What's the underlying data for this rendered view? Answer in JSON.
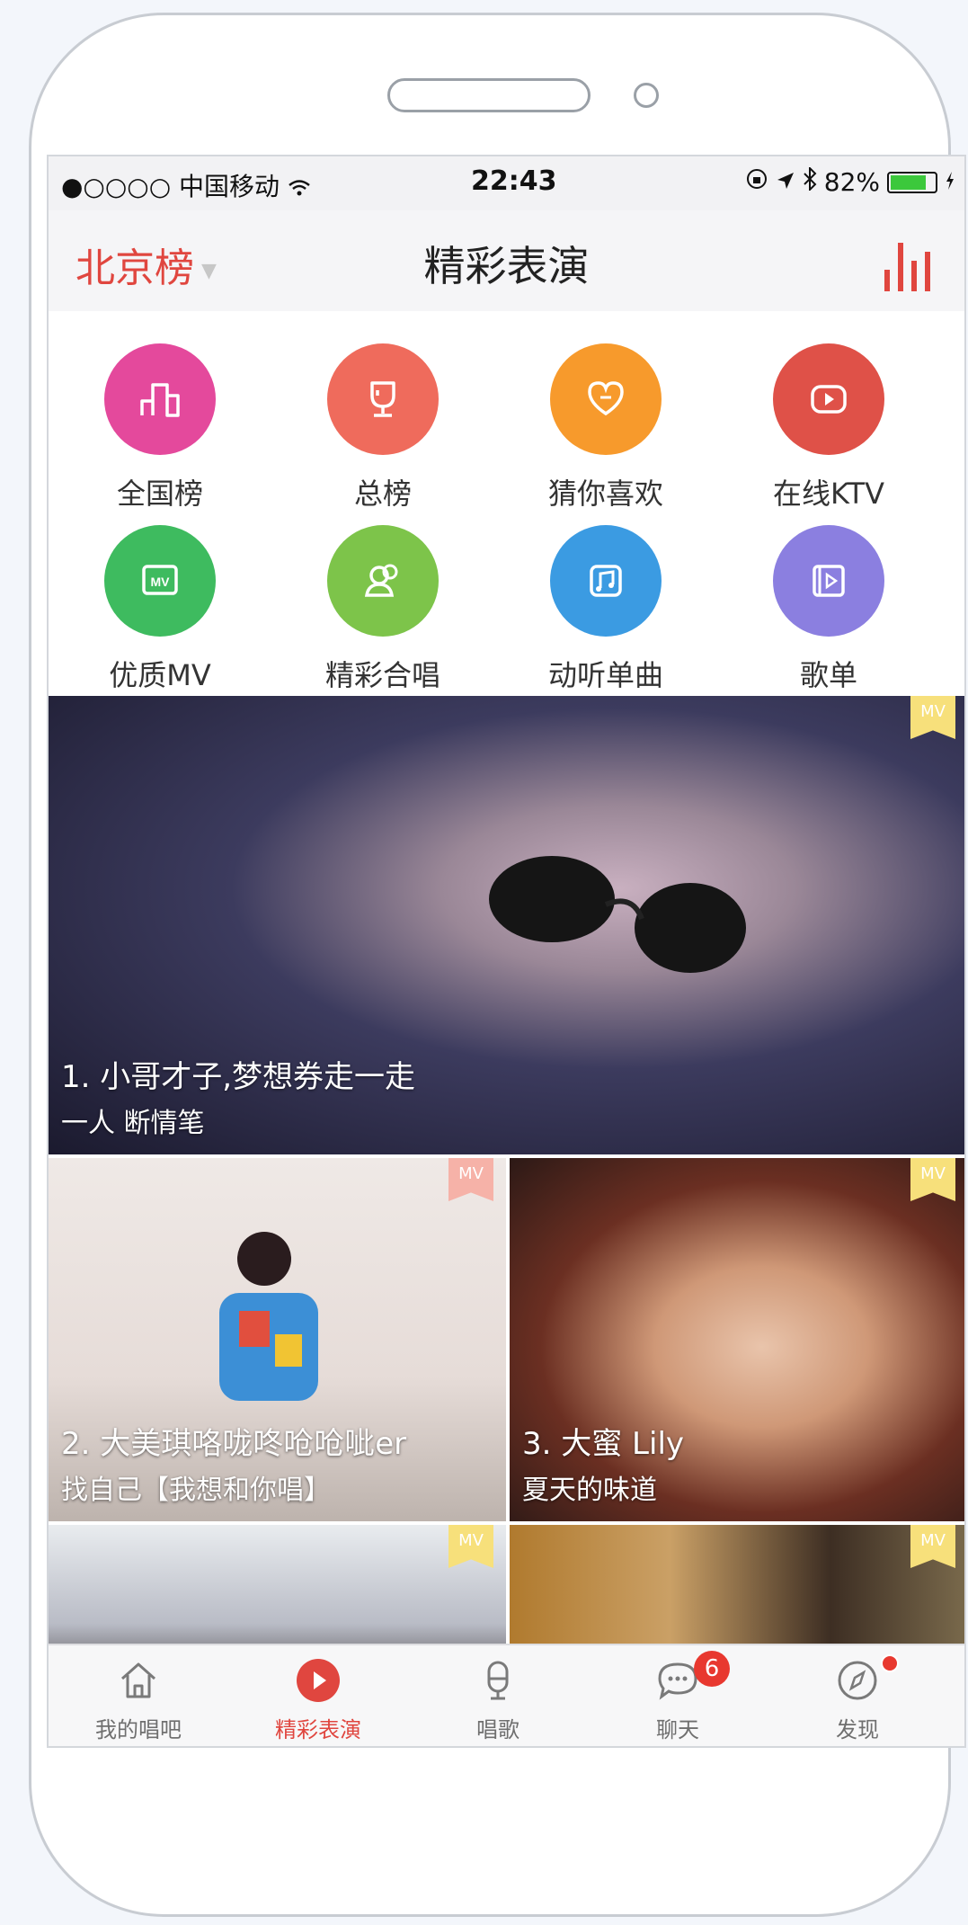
{
  "status_bar": {
    "carrier": "●○○○○ 中国移动",
    "time": "22:43",
    "battery_percent": "82%",
    "battery_level": 0.82
  },
  "nav": {
    "city": "北京榜",
    "title": "精彩表演"
  },
  "categories": [
    {
      "label": "全国榜",
      "icon": "chart-bars-icon",
      "color": "#e4499c"
    },
    {
      "label": "总榜",
      "icon": "trophy-icon",
      "color": "#ef6b5c"
    },
    {
      "label": "猜你喜欢",
      "icon": "heart-chat-icon",
      "color": "#f79a2c"
    },
    {
      "label": "在线KTV",
      "icon": "play-screen-icon",
      "color": "#df5148"
    },
    {
      "label": "优质MV",
      "icon": "mv-icon",
      "color": "#3ebb5f"
    },
    {
      "label": "精彩合唱",
      "icon": "duet-icon",
      "color": "#7dc44a"
    },
    {
      "label": "动听单曲",
      "icon": "music-note-icon",
      "color": "#3b9be2"
    },
    {
      "label": "歌单",
      "icon": "playlist-icon",
      "color": "#8b7fe0"
    }
  ],
  "feed": [
    {
      "title": "1. 小哥才子,梦想券走一走",
      "song": "一人 断情笔",
      "tag": "MV"
    },
    {
      "title": "2. 大美琪咯咙咚呛呛呲er",
      "song": "找自己【我想和你唱】",
      "tag": "MV"
    },
    {
      "title": "3. 大蜜 Lily",
      "song": "夏天的味道",
      "tag": "MV"
    },
    {
      "title": "",
      "song": "",
      "tag": "MV"
    },
    {
      "title": "",
      "song": "",
      "tag": "MV"
    }
  ],
  "tabs": [
    {
      "label": "我的唱吧",
      "icon": "home-icon"
    },
    {
      "label": "精彩表演",
      "icon": "play-circle-icon",
      "active": true
    },
    {
      "label": "唱歌",
      "icon": "microphone-icon"
    },
    {
      "label": "聊天",
      "icon": "chat-bubble-icon",
      "badge": "6"
    },
    {
      "label": "发现",
      "icon": "compass-icon"
    }
  ],
  "colors": {
    "accent": "#e0463f",
    "mv_tag": "#f7e07b"
  }
}
